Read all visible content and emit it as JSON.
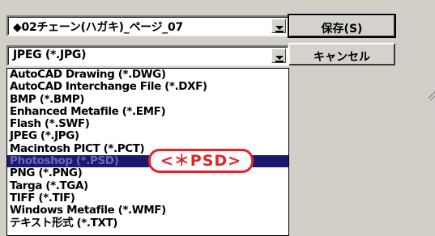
{
  "filename": {
    "value": "◆02チェーン(ハガキ)_ページ_07"
  },
  "filetype": {
    "value": "JPEG (*.JPG)"
  },
  "buttons": {
    "save": "保存(S)",
    "cancel": "キャンセル"
  },
  "list": {
    "items": [
      "AutoCAD Drawing (*.DWG)",
      "AutoCAD Interchange File (*.DXF)",
      "BMP (*.BMP)",
      "Enhanced Metafile (*.EMF)",
      "Flash (*.SWF)",
      "JPEG (*.JPG)",
      "Macintosh PICT (*.PCT)",
      "Photoshop (*.PSD)",
      "PNG (*.PNG)",
      "Targa (*.TGA)",
      "TIFF (*.TIF)",
      "Windows Metafile (*.WMF)",
      "テキスト形式 (*.TXT)"
    ],
    "selected_index": 7
  },
  "callout": {
    "text": "<＊PSD>"
  },
  "colors": {
    "selection": "#1c1a6e",
    "callout": "#e0252a"
  }
}
